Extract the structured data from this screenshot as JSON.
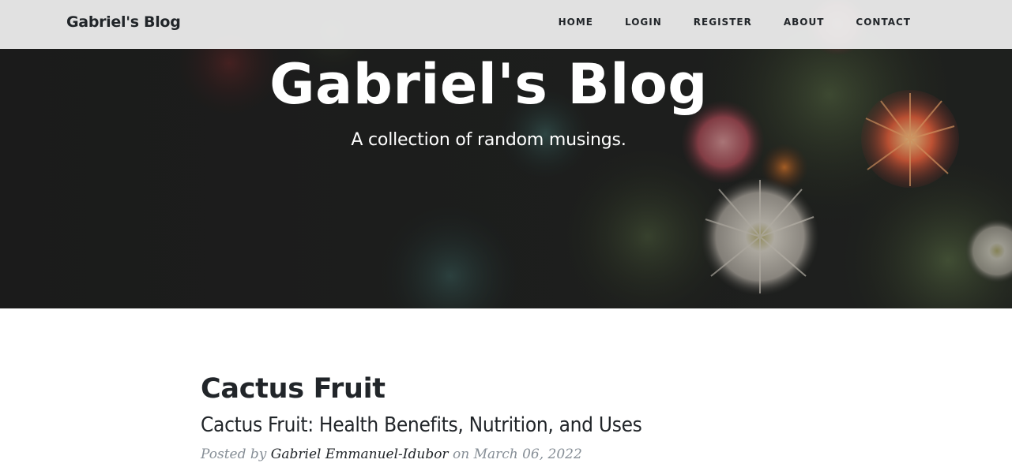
{
  "navbar": {
    "brand": "Gabriel's Blog",
    "links": [
      "HOME",
      "LOGIN",
      "REGISTER",
      "ABOUT",
      "CONTACT"
    ]
  },
  "hero": {
    "title": "Gabriel's Blog",
    "subtitle": "A collection of random musings."
  },
  "post": {
    "title": "Cactus Fruit",
    "subtitle": "Cactus Fruit: Health Benefits, Nutrition, and Uses",
    "meta_prefix": "Posted by",
    "author": "Gabriel Emmanuel-Idubor",
    "meta_on": "on",
    "date": "March 06, 2022"
  },
  "colors": {
    "text": "#212529",
    "muted": "#868e96",
    "hero_overlay": "#1c1c1c",
    "navbar_bg": "#f0f0f0"
  }
}
